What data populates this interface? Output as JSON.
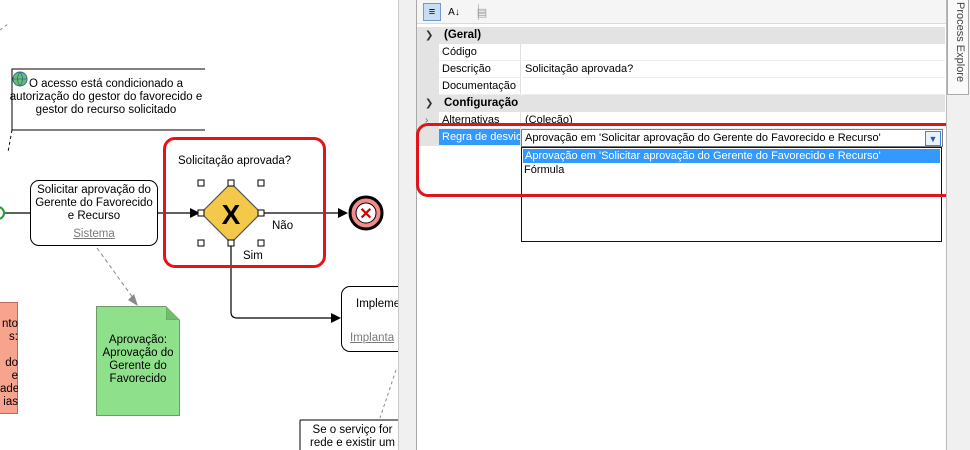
{
  "canvas": {
    "annotation": "O acesso está condicionado a autorização do gestor do favorecido e gestor do recurso solicitado",
    "task1": {
      "label": "Solicitar aprovação do Gerente do Favorecido e Recurso",
      "link": "Sistema"
    },
    "gateway": {
      "label": "Solicitação aprovada?",
      "no_label": "Não",
      "yes_label": "Sim"
    },
    "task2": {
      "label": "Impleme",
      "link": "Implanta"
    },
    "document": {
      "text": "Aprovação: Aprovação do Gerente do Favorecido"
    },
    "red_note": {
      "text": "nto\ns:\n\ndo\ne\nade\nias"
    },
    "note_bottom": {
      "text": "Se o serviço for\nrede e existir um"
    }
  },
  "toolbar": {
    "categorized_label": "≡",
    "alpha_label": "A↓",
    "pages_label": "▤"
  },
  "properties": {
    "categories": [
      {
        "label": "(Geral)",
        "rows": [
          {
            "name": "Código",
            "value": ""
          },
          {
            "name": "Descrição",
            "value": "Solicitação aprovada?"
          },
          {
            "name": "Documentação",
            "value": ""
          }
        ]
      },
      {
        "label": "Configuração",
        "rows": [
          {
            "name": "Alternativas",
            "value": "(Coleção)"
          },
          {
            "name": "Regra de desvio",
            "value": "Aprovação em 'Solicitar aprovação do Gerente do Favorecido e Recurso'"
          }
        ]
      }
    ]
  },
  "dropdown": {
    "selected": "Aprovação em 'Solicitar aprovação do Gerente do Favorecido e Recurso'",
    "options": [
      "Aprovação em 'Solicitar aprovação do Gerente do Favorecido e Recurso'",
      "Fórmula"
    ]
  },
  "side_tab": {
    "label": "Process Explore"
  },
  "colors": {
    "highlight": "#e2141a",
    "selection": "#3399ff",
    "document": "#8ee08a",
    "note": "#f7a38d",
    "gateway": "#f4c84a",
    "end_event": "#f28b8b"
  }
}
